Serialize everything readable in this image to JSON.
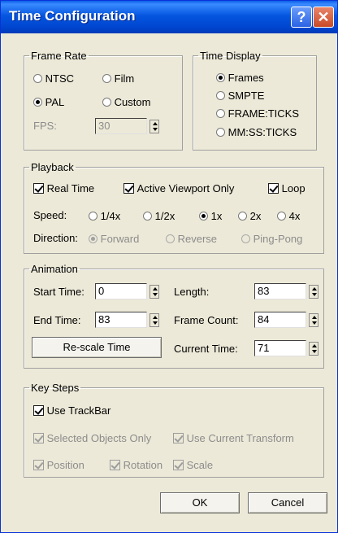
{
  "window": {
    "title": "Time Configuration",
    "help_glyph": "?",
    "close_glyph": "✕"
  },
  "frame_rate": {
    "legend": "Frame Rate",
    "options": [
      {
        "label": "NTSC",
        "checked": false
      },
      {
        "label": "Film",
        "checked": false
      },
      {
        "label": "PAL",
        "checked": true
      },
      {
        "label": "Custom",
        "checked": false
      }
    ],
    "fps_label": "FPS:",
    "fps_value": "30"
  },
  "time_display": {
    "legend": "Time Display",
    "options": [
      {
        "label": "Frames",
        "checked": true
      },
      {
        "label": "SMPTE",
        "checked": false
      },
      {
        "label": "FRAME:TICKS",
        "checked": false
      },
      {
        "label": "MM:SS:TICKS",
        "checked": false
      }
    ]
  },
  "playback": {
    "legend": "Playback",
    "real_time": "Real Time",
    "active_viewport": "Active Viewport Only",
    "loop": "Loop",
    "speed_label": "Speed:",
    "speeds": [
      {
        "label": "1/4x",
        "checked": false
      },
      {
        "label": "1/2x",
        "checked": false
      },
      {
        "label": "1x",
        "checked": true
      },
      {
        "label": "2x",
        "checked": false
      },
      {
        "label": "4x",
        "checked": false
      }
    ],
    "direction_label": "Direction:",
    "directions": [
      {
        "label": "Forward",
        "checked": true
      },
      {
        "label": "Reverse",
        "checked": false
      },
      {
        "label": "Ping-Pong",
        "checked": false
      }
    ]
  },
  "animation": {
    "legend": "Animation",
    "start_time_label": "Start Time:",
    "start_time": "0",
    "end_time_label": "End Time:",
    "end_time": "83",
    "length_label": "Length:",
    "length": "83",
    "frame_count_label": "Frame Count:",
    "frame_count": "84",
    "current_time_label": "Current Time:",
    "current_time": "71",
    "rescale_label": "Re-scale Time"
  },
  "key_steps": {
    "legend": "Key Steps",
    "use_trackbar": "Use TrackBar",
    "selected_only": "Selected Objects Only",
    "use_current_transform": "Use Current Transform",
    "position": "Position",
    "rotation": "Rotation",
    "scale": "Scale"
  },
  "buttons": {
    "ok": "OK",
    "cancel": "Cancel"
  }
}
